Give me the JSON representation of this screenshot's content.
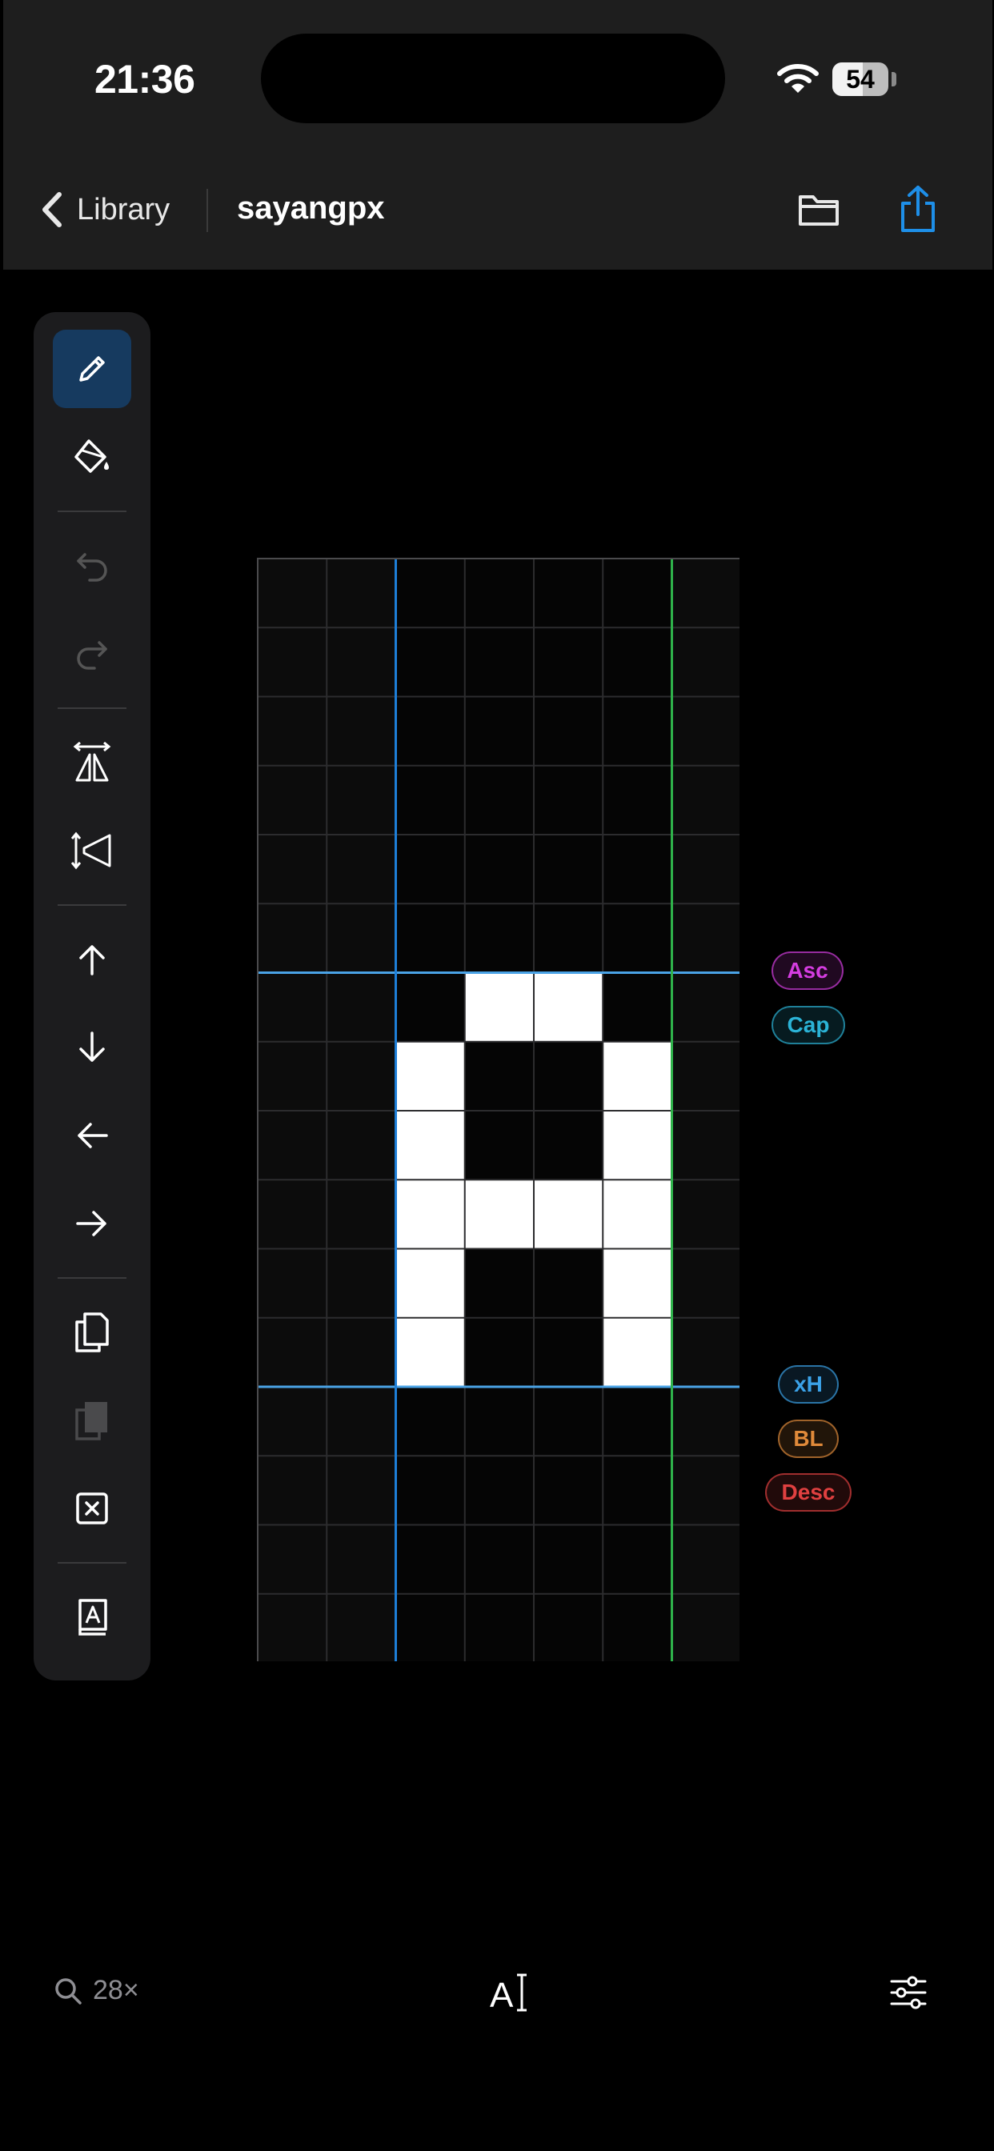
{
  "status_bar": {
    "time": "21:36",
    "battery_level": "54",
    "battery_fraction": 0.54,
    "icons": [
      "wifi-icon",
      "battery-icon"
    ]
  },
  "nav": {
    "back_label": "Library",
    "title": "sayangpx",
    "icons": [
      "chevron-left-icon",
      "folder-icon",
      "share-icon"
    ],
    "accent_color": "#1e8fe8"
  },
  "tools": [
    {
      "name": "pencil-icon",
      "active": true,
      "enabled": true
    },
    {
      "name": "paint-bucket-icon",
      "active": false,
      "enabled": true
    },
    {
      "name": "undo-icon",
      "active": false,
      "enabled": false
    },
    {
      "name": "redo-icon",
      "active": false,
      "enabled": false
    },
    {
      "name": "flip-horizontal-icon",
      "active": false,
      "enabled": true
    },
    {
      "name": "flip-vertical-icon",
      "active": false,
      "enabled": true
    },
    {
      "name": "arrow-up-icon",
      "active": false,
      "enabled": true
    },
    {
      "name": "arrow-down-icon",
      "active": false,
      "enabled": true
    },
    {
      "name": "arrow-left-icon",
      "active": false,
      "enabled": true
    },
    {
      "name": "arrow-right-icon",
      "active": false,
      "enabled": true
    },
    {
      "name": "copy-icon",
      "active": false,
      "enabled": true
    },
    {
      "name": "paste-icon",
      "active": false,
      "enabled": false
    },
    {
      "name": "clear-icon",
      "active": false,
      "enabled": true
    },
    {
      "name": "glyph-book-icon",
      "active": false,
      "enabled": true
    }
  ],
  "glyph": {
    "columns": 7,
    "rows": 16,
    "left_bearing_column": 2,
    "right_bearing_column": 6,
    "ascender_row": 6,
    "baseline_row": 12,
    "filled_cells": [
      [
        6,
        3
      ],
      [
        6,
        4
      ],
      [
        7,
        2
      ],
      [
        7,
        5
      ],
      [
        8,
        2
      ],
      [
        8,
        5
      ],
      [
        9,
        2
      ],
      [
        9,
        3
      ],
      [
        9,
        4
      ],
      [
        9,
        5
      ],
      [
        10,
        2
      ],
      [
        10,
        5
      ],
      [
        11,
        2
      ],
      [
        11,
        5
      ]
    ],
    "colors": {
      "left_bearing": "#1e7fd8",
      "right_bearing": "#2fb24a",
      "metric_line": "#4aa3e6"
    }
  },
  "metrics": [
    {
      "label": "Asc",
      "color": "#d43de0"
    },
    {
      "label": "Cap",
      "color": "#2bb3d6"
    },
    {
      "label": "xH",
      "color": "#3ba2e8"
    },
    {
      "label": "BL",
      "color": "#e08a3a"
    },
    {
      "label": "Desc",
      "color": "#e04040"
    }
  ],
  "bottom_bar": {
    "zoom_label": "28×",
    "font_label": "A",
    "icons": [
      "magnifier-icon",
      "text-cursor-icon",
      "sliders-icon"
    ]
  }
}
